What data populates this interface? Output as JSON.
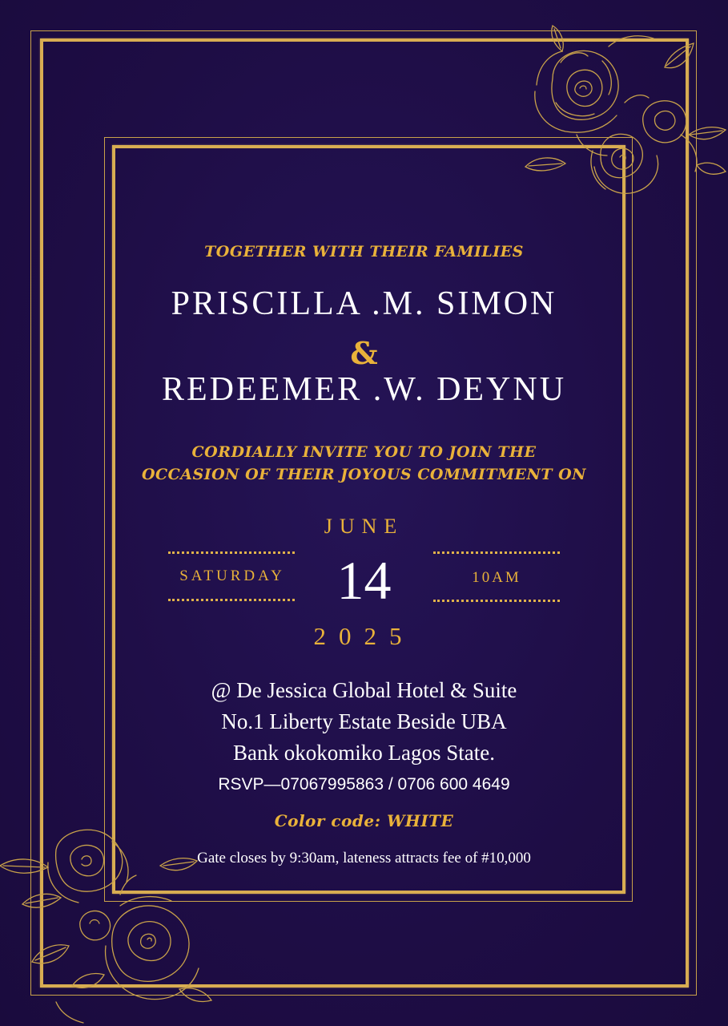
{
  "colors": {
    "background": "#1e0d45",
    "gold": "#d8ad52",
    "text_gold": "#e9b23a",
    "text_white": "#ffffff"
  },
  "decorations": {
    "top_right": "rose-bouquet-icon",
    "bottom_left": "rose-bouquet-icon"
  },
  "header": {
    "together": "TOGETHER WITH THEIR FAMILIES"
  },
  "couple": {
    "name1": "PRISCILLA .M. SIMON",
    "ampersand": "&",
    "name2": "REDEEMER .W. DEYNU"
  },
  "invitation": {
    "line1": "CORDIALLY INVITE YOU TO JOIN THE",
    "line2": "OCCASION OF THEIR JOYOUS COMMITMENT ON"
  },
  "date": {
    "month": "JUNE",
    "weekday": "SATURDAY",
    "day": "14",
    "time": "10AM",
    "year": "2025"
  },
  "venue": {
    "line1": "@ De Jessica Global Hotel & Suite",
    "line2": "No.1 Liberty Estate Beside UBA",
    "line3": "Bank okokomiko Lagos State."
  },
  "rsvp": "RSVP—07067995863 / 0706 600 4649",
  "color_code": "Color code: WHITE",
  "gate_notice": "Gate closes by 9:30am, lateness attracts fee of #10,000"
}
